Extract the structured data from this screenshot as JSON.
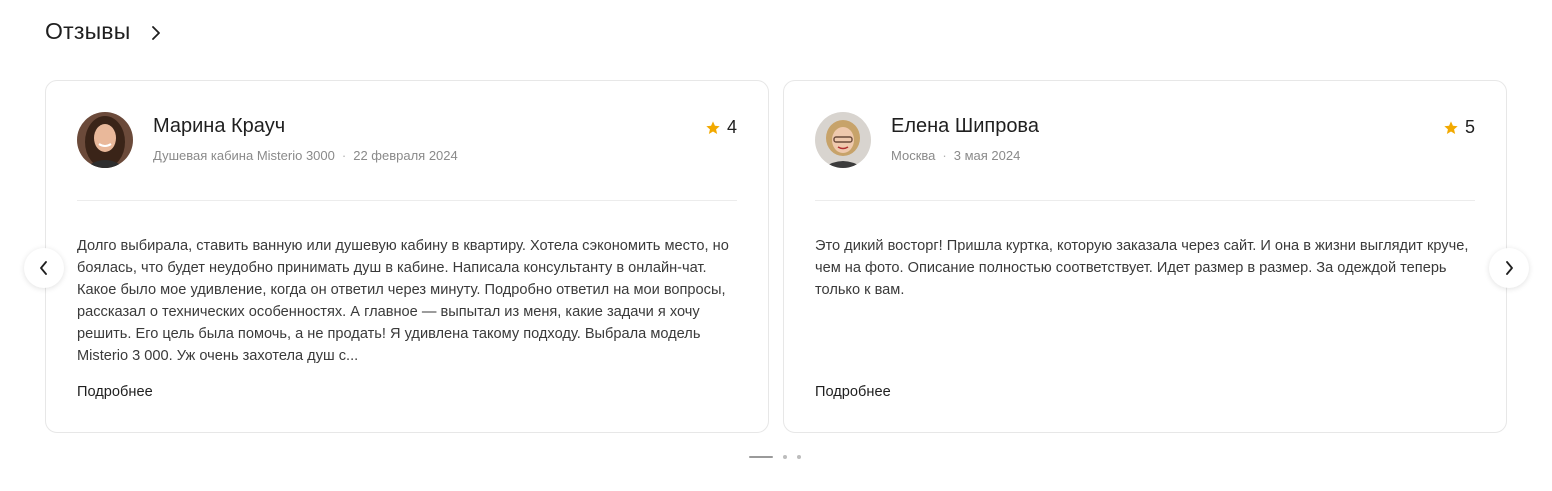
{
  "section": {
    "title": "Отзывы",
    "arrow_icon": "chevron-right-icon"
  },
  "colors": {
    "star": "#F2A900",
    "text_primary": "#1f1f1f",
    "text_secondary": "#8a8a8a",
    "border": "#e7e7e7"
  },
  "reviews": [
    {
      "author": "Марина Крауч",
      "product": "Душевая кабина Misterio 3000",
      "date": "22 февраля 2024",
      "rating": "4",
      "text": "Долго выбирала, ставить ванную или душевую кабину в квартиру. Хотела сэкономить место, но боялась, что будет неудобно принимать душ в кабине. Написала консультанту в онлайн-чат. Какое было мое удивление, когда он ответил через минуту. Подробно ответил на мои вопросы, рассказал о технических особенностях. А главное — выпытал из меня, какие задачи я хочу решить. Его цель была помочь, а не продать! Я удивлена такому подходу. Выбрала модель Misterio 3 000. Уж очень захотела душ с...",
      "more_label": "Подробнее"
    },
    {
      "author": "Елена Шипрова",
      "product": "Москва",
      "date": "3 мая 2024",
      "rating": "5",
      "text": "Это дикий восторг! Пришла куртка, которую заказала через сайт. И она в жизни выглядит круче, чем на фото. Описание полностью соответствует. Идет размер в размер. За одеждой теперь только к вам.",
      "more_label": "Подробнее"
    }
  ],
  "pagination": {
    "pages": 3,
    "current": 1
  },
  "nav": {
    "prev_icon": "chevron-left-icon",
    "next_icon": "chevron-right-icon"
  }
}
